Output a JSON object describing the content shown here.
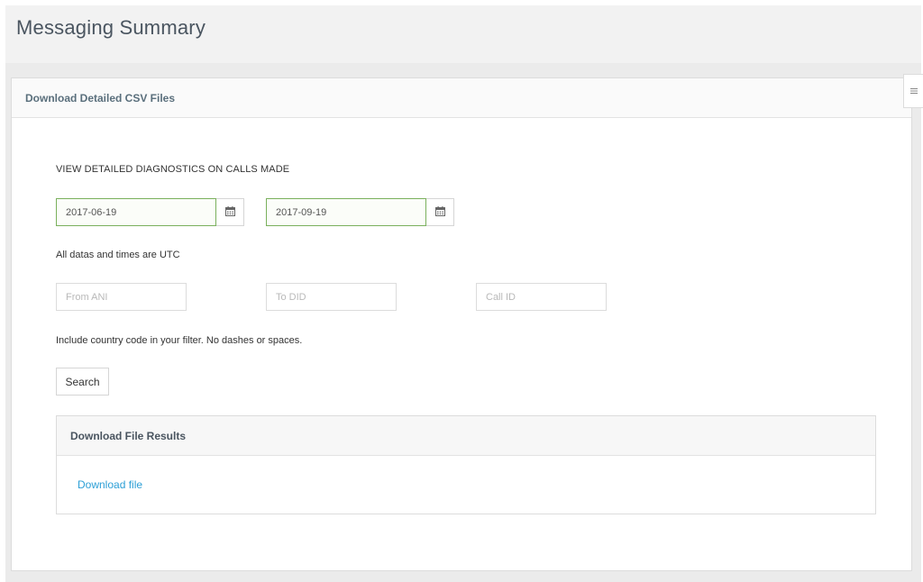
{
  "page": {
    "title": "Messaging Summary"
  },
  "panel": {
    "title": "Download Detailed CSV Files"
  },
  "diagnostics": {
    "heading": "VIEW DETAILED DIAGNOSTICS ON CALLS MADE",
    "start_date": "2017-06-19",
    "end_date": "2017-09-19",
    "timezone_note": "All datas and times are UTC",
    "filters": {
      "from_ani_placeholder": "From ANI",
      "to_did_placeholder": "To DID",
      "call_id_placeholder": "Call ID"
    },
    "filter_note": "Include country code in your filter. No dashes or spaces.",
    "search_label": "Search"
  },
  "results": {
    "title": "Download File Results",
    "download_label": "Download file"
  },
  "icons": {
    "calendar": "calendar-icon",
    "side_menu": "menu-icon"
  },
  "colors": {
    "date_border": "#7ab05c",
    "link": "#2c9fd6",
    "title_text": "#4a5560"
  }
}
